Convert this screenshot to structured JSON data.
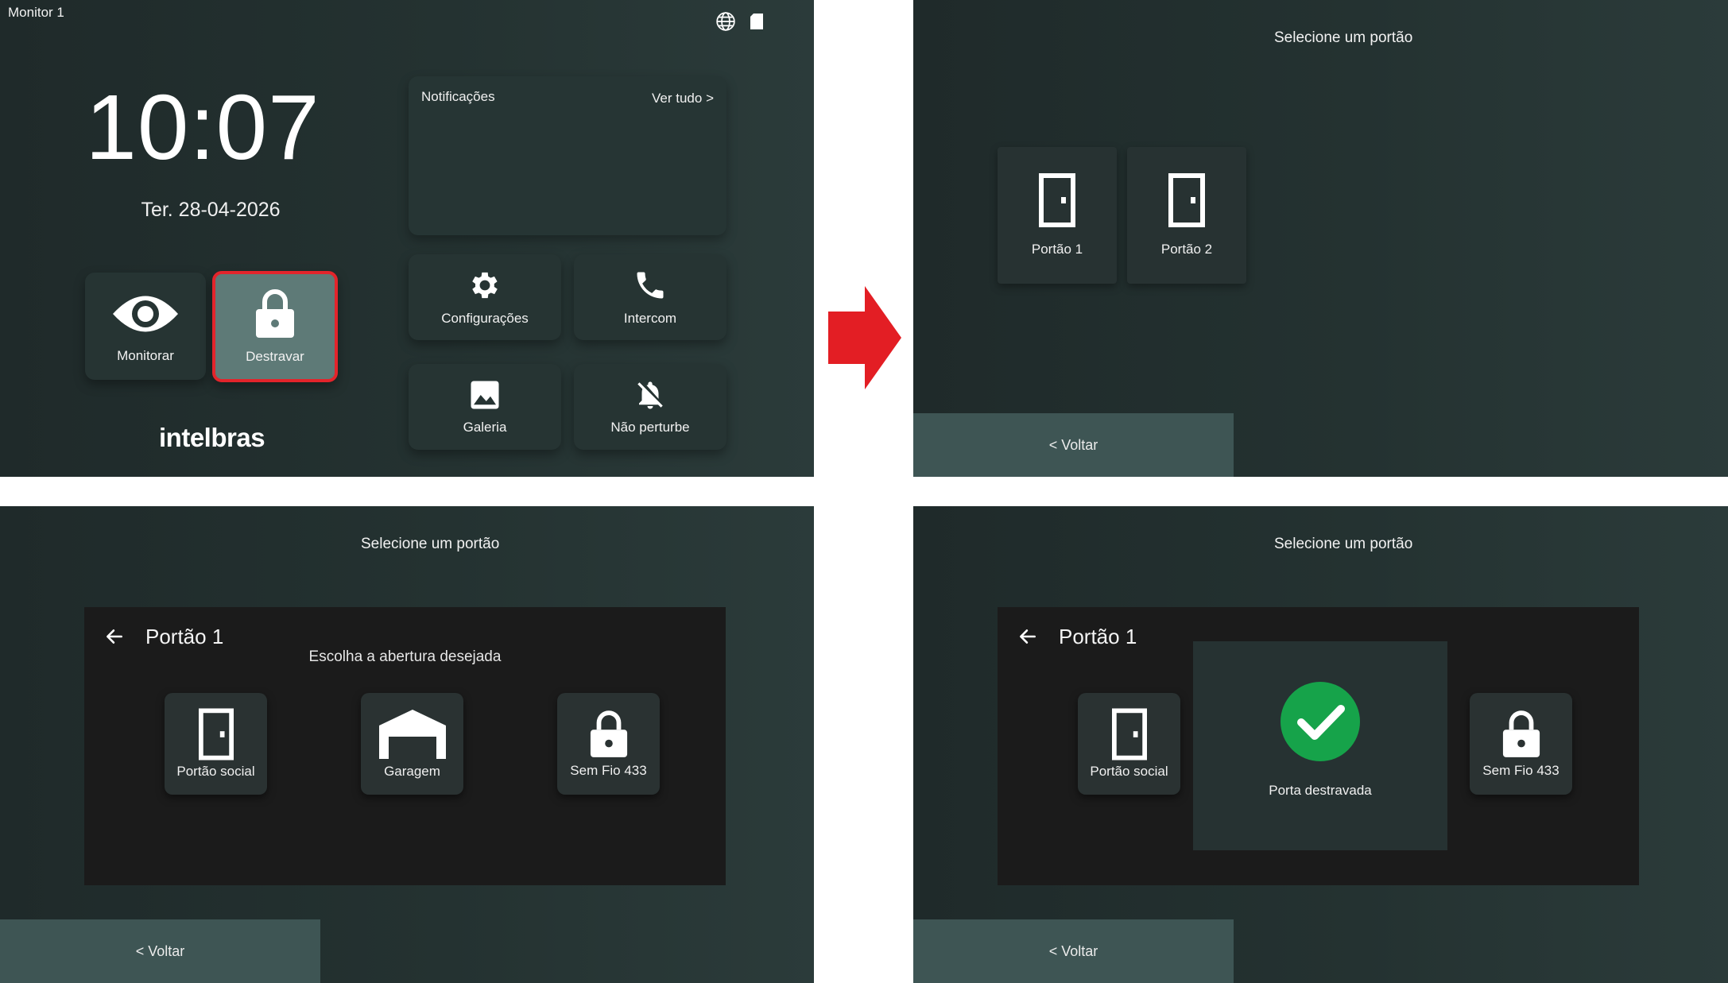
{
  "home": {
    "monitor_label": "Monitor 1",
    "time": "10:07",
    "date": "Ter. 28-04-2026",
    "notifications_title": "Notificações",
    "notifications_link": "Ver tudo >",
    "tiles": {
      "monitor": "Monitorar",
      "unlock": "Destravar",
      "settings": "Configurações",
      "intercom": "Intercom",
      "gallery": "Galeria",
      "dnd": "Não perturbe"
    },
    "brand": "intelbras"
  },
  "gate_select": {
    "title": "Selecione um portão",
    "gates": [
      "Portão 1",
      "Portão 2"
    ],
    "back": "< Voltar"
  },
  "gate_options": {
    "title": "Selecione um portão",
    "dialog_title": "Portão 1",
    "subtitle": "Escolha a abertura desejada",
    "options": [
      "Portão social",
      "Garagem",
      "Sem Fio 433"
    ],
    "back": "< Voltar"
  },
  "gate_unlocked": {
    "title": "Selecione um portão",
    "dialog_title": "Portão 1",
    "options": [
      "Portão social",
      "Sem Fio 433"
    ],
    "message": "Porta destravada",
    "back": "< Voltar"
  },
  "colors": {
    "background": "#243231",
    "highlight_border": "#e3242b",
    "arrow": "#e31e24",
    "success": "#16a34a"
  }
}
